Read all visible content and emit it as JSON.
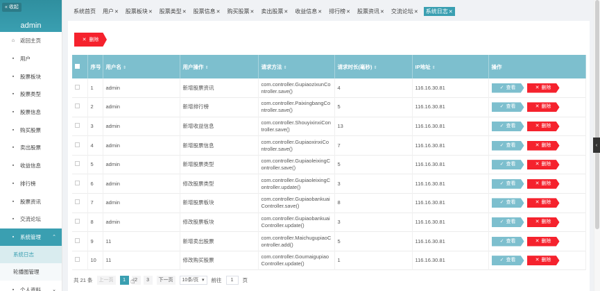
{
  "sidebar": {
    "collapse_label": "« 收起",
    "admin_name": "admin",
    "items": [
      {
        "label": "返回主页",
        "icon": "home-icon",
        "glyph": "⌂"
      },
      {
        "label": "用户",
        "icon": "user-icon",
        "glyph": "▪"
      },
      {
        "label": "股票板块",
        "icon": "board-icon",
        "glyph": "▪"
      },
      {
        "label": "股票类型",
        "icon": "type-icon",
        "glyph": "▪"
      },
      {
        "label": "股票信息",
        "icon": "info-icon",
        "glyph": "▪"
      },
      {
        "label": "购买股票",
        "icon": "buy-icon",
        "glyph": "▪"
      },
      {
        "label": "卖出股票",
        "icon": "sell-icon",
        "glyph": "▪"
      },
      {
        "label": "收益信息",
        "icon": "income-icon",
        "glyph": "▪"
      },
      {
        "label": "排行榜",
        "icon": "rank-icon",
        "glyph": "▪"
      },
      {
        "label": "股票资讯",
        "icon": "news-icon",
        "glyph": "▪"
      },
      {
        "label": "交流论坛",
        "icon": "forum-icon",
        "glyph": "▪"
      },
      {
        "label": "系统管理",
        "icon": "system-icon",
        "glyph": "▪"
      }
    ],
    "sub_items": [
      "系统日志",
      "轮播图管理"
    ],
    "personal": {
      "label": "个人资料",
      "glyph": "▪"
    }
  },
  "tabs": [
    {
      "label": "系统首页",
      "closable": false
    },
    {
      "label": "用户",
      "closable": true
    },
    {
      "label": "股票板块",
      "closable": true
    },
    {
      "label": "股票类型",
      "closable": true
    },
    {
      "label": "股票信息",
      "closable": true
    },
    {
      "label": "购买股票",
      "closable": true
    },
    {
      "label": "卖出股票",
      "closable": true
    },
    {
      "label": "收益信息",
      "closable": true
    },
    {
      "label": "排行榜",
      "closable": true
    },
    {
      "label": "股票资讯",
      "closable": true
    },
    {
      "label": "交流论坛",
      "closable": true
    },
    {
      "label": "系统日志",
      "closable": true,
      "active": true
    }
  ],
  "toolbar": {
    "batch_delete_label": "删除"
  },
  "table": {
    "headers": [
      "序号",
      "用户名",
      "用户操作",
      "请求方法",
      "请求时长(毫秒)",
      "IP地址",
      "操作"
    ],
    "view_label": "查看",
    "delete_label": "删除",
    "rows": [
      {
        "no": "1",
        "user": "admin",
        "op": "新增股票资讯",
        "method": "com.controller.GupiaozixunController.save()",
        "ms": "4",
        "ip": "116.16.30.81"
      },
      {
        "no": "2",
        "user": "admin",
        "op": "新增排行榜",
        "method": "com.controller.PaixingbangController.save()",
        "ms": "5",
        "ip": "116.16.30.81"
      },
      {
        "no": "3",
        "user": "admin",
        "op": "新增收益信息",
        "method": "com.controller.ShouyixinxiController.save()",
        "ms": "13",
        "ip": "116.16.30.81"
      },
      {
        "no": "4",
        "user": "admin",
        "op": "新增股票信息",
        "method": "com.controller.GupiaoxinxiController.save()",
        "ms": "7",
        "ip": "116.16.30.81"
      },
      {
        "no": "5",
        "user": "admin",
        "op": "新增股票类型",
        "method": "com.controller.GupiaoleixingController.save()",
        "ms": "5",
        "ip": "116.16.30.81"
      },
      {
        "no": "6",
        "user": "admin",
        "op": "修改股票类型",
        "method": "com.controller.GupiaoleixingController.update()",
        "ms": "3",
        "ip": "116.16.30.81"
      },
      {
        "no": "7",
        "user": "admin",
        "op": "新增股票板块",
        "method": "com.controller.GupiaobankuaiController.save()",
        "ms": "8",
        "ip": "116.16.30.81"
      },
      {
        "no": "8",
        "user": "admin",
        "op": "修改股票板块",
        "method": "com.controller.GupiaobankuaiController.update()",
        "ms": "3",
        "ip": "116.16.30.81"
      },
      {
        "no": "9",
        "user": "11",
        "op": "新增卖出股票",
        "method": "com.controller.MaichugupiaoController.add()",
        "ms": "5",
        "ip": "116.16.30.81"
      },
      {
        "no": "10",
        "user": "11",
        "op": "修改购买股票",
        "method": "com.controller.GoumaigupiaoController.update()",
        "ms": "1",
        "ip": "116.16.30.81"
      }
    ]
  },
  "pager": {
    "total_prefix": "共",
    "total": "21",
    "total_suffix": "条",
    "prev_label": "上一页",
    "next_label": "下一页",
    "pages": [
      "1",
      "2",
      "3"
    ],
    "current": "1",
    "page_size_label": "10条/页",
    "goto_label": "前往",
    "goto_value": "1",
    "page_suffix": "页"
  },
  "colors": {
    "accent": "#3a9fb1",
    "header": "#7dbfce",
    "danger": "#f5222d"
  }
}
